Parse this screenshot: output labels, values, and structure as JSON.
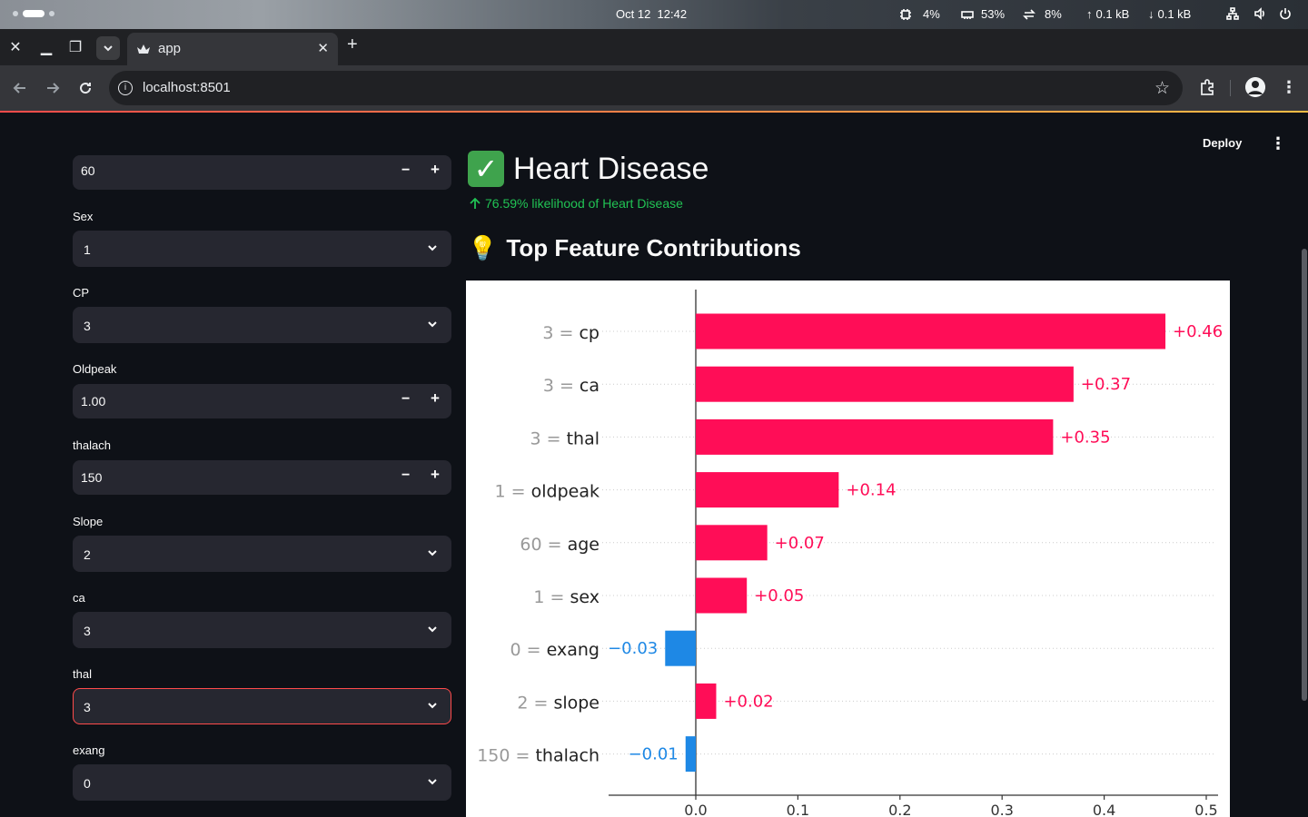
{
  "os": {
    "date": "Oct 12",
    "time": "12:42",
    "cpu": "4%",
    "memory": "53%",
    "swap": "8%",
    "upload": "0.1 kB",
    "download": "0.1 kB"
  },
  "browser": {
    "tab_title": "app",
    "url": "localhost:8501"
  },
  "app": {
    "deploy_label": "Deploy"
  },
  "sidebar": {
    "age": {
      "value": "60"
    },
    "sex": {
      "label": "Sex",
      "value": "1"
    },
    "cp": {
      "label": "CP",
      "value": "3"
    },
    "oldpeak": {
      "label": "Oldpeak",
      "value": "1.00"
    },
    "thalach": {
      "label": "thalach",
      "value": "150"
    },
    "slope": {
      "label": "Slope",
      "value": "2"
    },
    "ca": {
      "label": "ca",
      "value": "3"
    },
    "thal": {
      "label": "thal",
      "value": "3"
    },
    "exang": {
      "label": "exang",
      "value": "0"
    }
  },
  "result": {
    "verdict": "Heart Disease",
    "likelihood": "76.59% likelihood of Heart Disease",
    "section_title": "Top Feature Contributions"
  },
  "colors": {
    "positive": "#ff0d57",
    "negative": "#1e88e5",
    "accent": "#ff4b4b",
    "success": "#21c354"
  },
  "chart_data": {
    "type": "bar",
    "orientation": "horizontal",
    "categories": [
      "3 = cp",
      "3 = ca",
      "3 = thal",
      "1 = oldpeak",
      "60 = age",
      "1 = sex",
      "0 = exang",
      "2 = slope",
      "150 = thalach"
    ],
    "feature_values": [
      "3",
      "3",
      "3",
      "1",
      "60",
      "1",
      "0",
      "2",
      "150"
    ],
    "feature_names": [
      "cp",
      "ca",
      "thal",
      "oldpeak",
      "age",
      "sex",
      "exang",
      "slope",
      "thalach"
    ],
    "values": [
      0.46,
      0.37,
      0.35,
      0.14,
      0.07,
      0.05,
      -0.03,
      0.02,
      -0.01
    ],
    "value_labels": [
      "+0.46",
      "+0.37",
      "+0.35",
      "+0.14",
      "+0.07",
      "+0.05",
      "−0.03",
      "+0.02",
      "−0.01"
    ],
    "xticks": [
      "0.0",
      "0.1",
      "0.2",
      "0.3",
      "0.4",
      "0.5"
    ],
    "xlim": [
      -0.085,
      0.51
    ],
    "grid": "horizontal dotted lines per row"
  }
}
